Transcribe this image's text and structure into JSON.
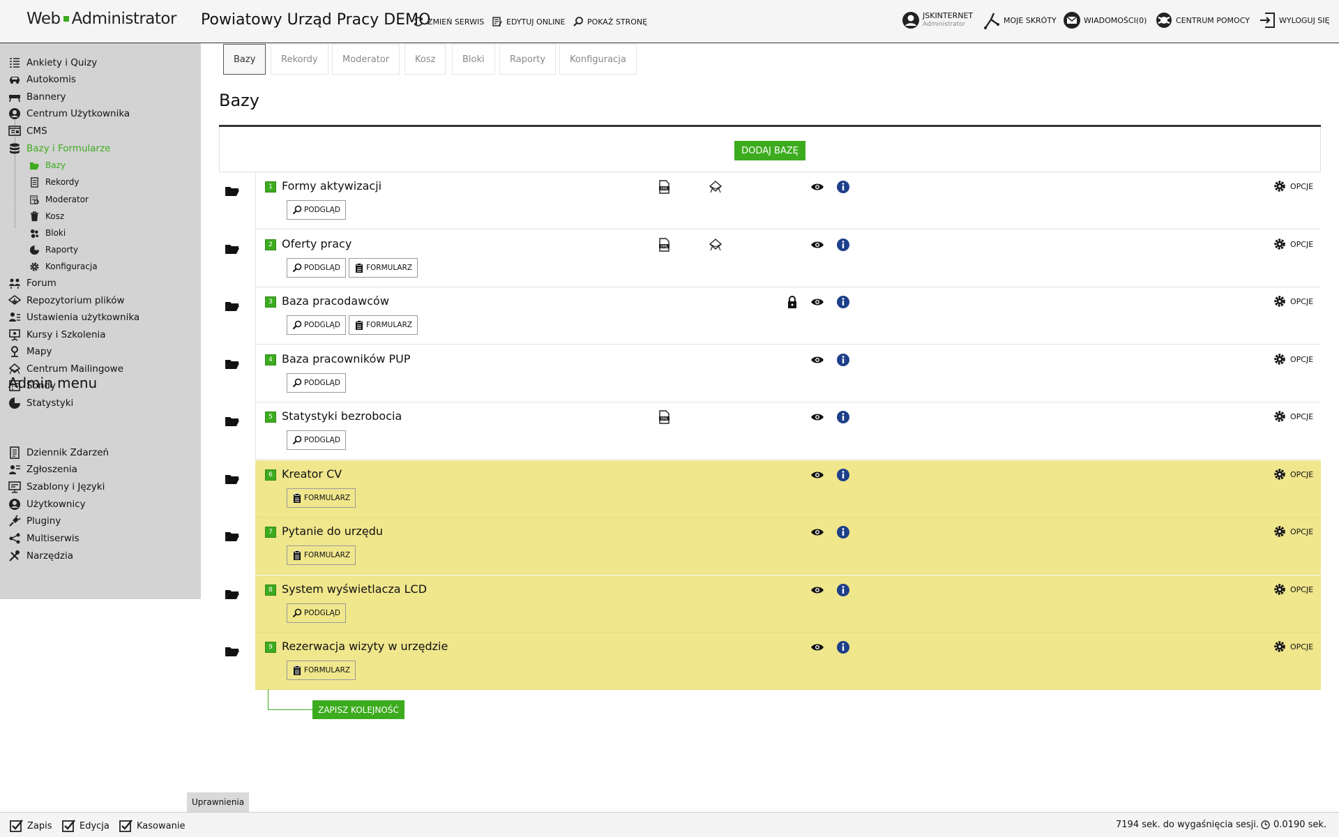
{
  "header": {
    "logo_left": "Web",
    "logo_right": "Administrator",
    "site_title": "Powiatowy Urząd Pracy DEMO",
    "actions": [
      "ZMIEŃ SERWIS",
      "EDYTUJ ONLINE",
      "POKAŻ STRONĘ"
    ],
    "user_name": "JSKINTERNET",
    "user_role": "Administrator",
    "shortcuts": "MOJE SKRÓTY",
    "messages": "WIADOMOŚCI(0)",
    "help": "CENTRUM POMOCY",
    "logout": "WYLOGUJ SIĘ"
  },
  "sidebar": {
    "items": [
      {
        "label": "Ankiety i Quizy",
        "icon": "survey-icon"
      },
      {
        "label": "Autokomis",
        "icon": "car-icon"
      },
      {
        "label": "Bannery",
        "icon": "banner-icon"
      },
      {
        "label": "Centrum Użytkownika",
        "icon": "user-center-icon"
      },
      {
        "label": "CMS",
        "icon": "cms-icon"
      },
      {
        "label": "Bazy i Formularze",
        "icon": "database-icon"
      }
    ],
    "sub_items": [
      {
        "label": "Bazy",
        "icon": "folder-open-icon"
      },
      {
        "label": "Rekordy",
        "icon": "document-icon"
      },
      {
        "label": "Moderator",
        "icon": "moderator-icon"
      },
      {
        "label": "Kosz",
        "icon": "trash-icon"
      },
      {
        "label": "Bloki",
        "icon": "blocks-icon"
      },
      {
        "label": "Raporty",
        "icon": "pie-chart-icon"
      },
      {
        "label": "Konfiguracja",
        "icon": "gear-icon"
      }
    ],
    "items_after": [
      {
        "label": "Forum",
        "icon": "forum-icon"
      },
      {
        "label": "Repozytorium plików",
        "icon": "repository-icon"
      },
      {
        "label": "Ustawienia użytkownika",
        "icon": "user-settings-icon"
      },
      {
        "label": "Kursy i Szkolenia",
        "icon": "presentation-icon"
      },
      {
        "label": "Mapy",
        "icon": "map-pin-icon"
      },
      {
        "label": "Centrum Mailingowe",
        "icon": "mail-center-icon"
      },
      {
        "label": "Sondy",
        "icon": "poll-icon"
      },
      {
        "label": "Statystyki",
        "icon": "stats-icon"
      }
    ],
    "admin_title": "Admin menu",
    "admin_items": [
      {
        "label": "Dziennik Zdarzeń",
        "icon": "log-icon"
      },
      {
        "label": "Zgłoszenia",
        "icon": "tickets-icon"
      },
      {
        "label": "Szablony i Języki",
        "icon": "templates-icon"
      },
      {
        "label": "Użytkownicy",
        "icon": "users-icon"
      },
      {
        "label": "Pluginy",
        "icon": "plugin-icon"
      },
      {
        "label": "Multiserwis",
        "icon": "share-icon"
      },
      {
        "label": "Narzędzia",
        "icon": "tools-icon"
      }
    ]
  },
  "tabs": [
    "Bazy",
    "Rekordy",
    "Moderator",
    "Kosz",
    "Bloki",
    "Raporty",
    "Konfiguracja"
  ],
  "page_title": "Bazy",
  "add_button": "DODAJ BAZĘ",
  "preview_label": "PODGLĄD",
  "form_label": "FORMULARZ",
  "options_label": "OPCJE",
  "rows": [
    {
      "num": "1",
      "name": "Formy aktywizacji",
      "highlight": false,
      "preview": true,
      "form": false,
      "xml": true,
      "mail": true,
      "lock": false
    },
    {
      "num": "2",
      "name": "Oferty pracy",
      "highlight": false,
      "preview": true,
      "form": true,
      "xml": true,
      "mail": true,
      "lock": false
    },
    {
      "num": "3",
      "name": "Baza pracodawców",
      "highlight": false,
      "preview": true,
      "form": true,
      "xml": false,
      "mail": false,
      "lock": true
    },
    {
      "num": "4",
      "name": "Baza pracowników PUP",
      "highlight": false,
      "preview": true,
      "form": false,
      "xml": false,
      "mail": false,
      "lock": false
    },
    {
      "num": "5",
      "name": "Statystyki bezrobocia",
      "highlight": false,
      "preview": true,
      "form": false,
      "xml": true,
      "mail": false,
      "lock": false
    },
    {
      "num": "6",
      "name": "Kreator CV",
      "highlight": true,
      "preview": false,
      "form": true,
      "xml": false,
      "mail": false,
      "lock": false
    },
    {
      "num": "7",
      "name": "Pytanie do urzędu",
      "highlight": true,
      "preview": false,
      "form": true,
      "xml": false,
      "mail": false,
      "lock": false
    },
    {
      "num": "8",
      "name": "System wyświetlacza LCD",
      "highlight": true,
      "preview": true,
      "form": false,
      "xml": false,
      "mail": false,
      "lock": false
    },
    {
      "num": "9",
      "name": "Rezerwacja wizyty w urzędzie",
      "highlight": true,
      "preview": false,
      "form": true,
      "xml": false,
      "mail": false,
      "lock": false
    }
  ],
  "save_order": "ZAPISZ KOLEJNOŚĆ",
  "permissions_tab": "Uprawnienia",
  "footer": {
    "checks": [
      "Zapis",
      "Edycja",
      "Kasowanie"
    ],
    "session": "7194 sek. do wygaśnięcia sesji.",
    "time": "0.0190 sek."
  },
  "colors": {
    "accent": "#3cab1e",
    "highlight_row": "#f0e68c",
    "sidebar_bg": "#d3d3d3"
  }
}
